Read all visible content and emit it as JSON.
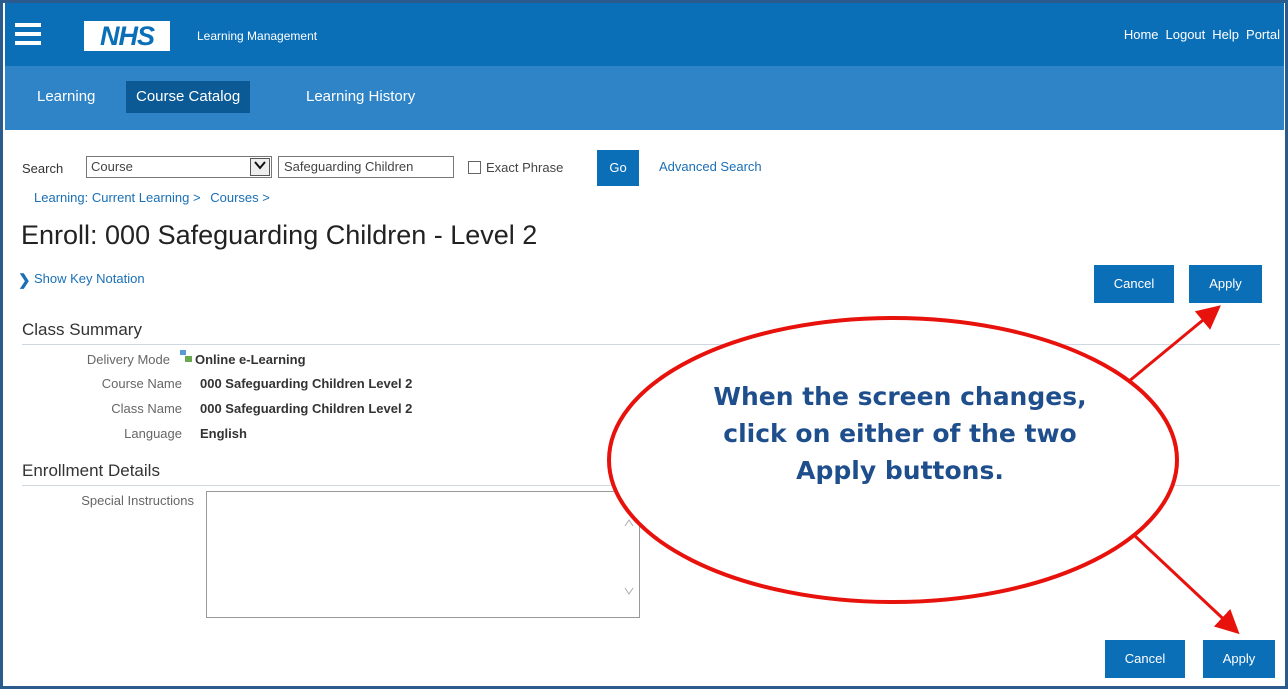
{
  "header": {
    "logo": "NHS",
    "app_title": "Learning Management",
    "links": [
      "Home",
      "Logout",
      "Help",
      "Portal"
    ]
  },
  "tabs": [
    {
      "label": "Learning",
      "active": false
    },
    {
      "label": "Course Catalog",
      "active": true
    },
    {
      "label": "Learning History",
      "active": false
    }
  ],
  "search": {
    "label": "Search",
    "type_value": "Course",
    "query_value": "Safeguarding Children",
    "exact_phrase_label": "Exact Phrase",
    "exact_phrase_checked": false,
    "go_label": "Go",
    "advanced_label": "Advanced Search"
  },
  "breadcrumb": [
    "Learning: Current Learning >",
    "Courses >"
  ],
  "page_title": "Enroll: 000 Safeguarding Children - Level 2",
  "show_key_label": "Show Key Notation",
  "buttons": {
    "cancel": "Cancel",
    "apply": "Apply"
  },
  "class_summary": {
    "title": "Class Summary",
    "rows": [
      {
        "label": "Delivery Mode",
        "value": "Online e-Learning"
      },
      {
        "label": "Course Name",
        "value": "000 Safeguarding Children Level 2"
      },
      {
        "label": "Class Name",
        "value": "000 Safeguarding Children Level 2"
      },
      {
        "label": "Language",
        "value": "English"
      }
    ]
  },
  "enrollment": {
    "title": "Enrollment Details",
    "special_label": "Special Instructions",
    "special_value": ""
  },
  "callout": {
    "text": "When the screen changes, click on either of the two Apply buttons.",
    "color": "#e8120c"
  },
  "colors": {
    "nhs_blue": "#0b6fb8",
    "tab_bar": "#2f84c7",
    "callout_text": "#1f4e8c"
  }
}
